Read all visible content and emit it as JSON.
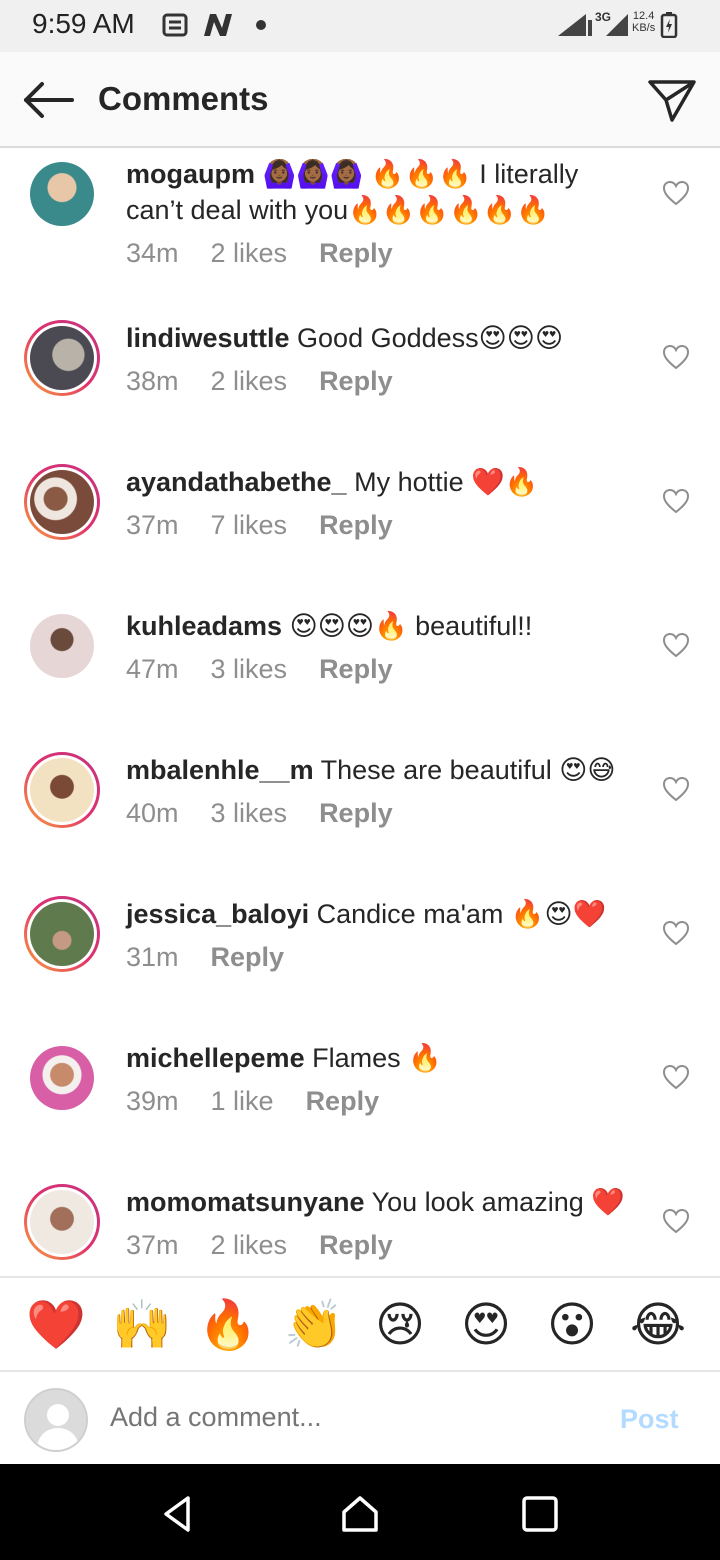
{
  "status_bar": {
    "time": "9:59 AM",
    "network": "3G",
    "speed_value": "12.4",
    "speed_unit": "KB/s",
    "icons": [
      "notification-icon",
      "n-app-icon",
      "signal-icon",
      "battery-icon"
    ]
  },
  "header": {
    "title": "Comments",
    "back_icon": "arrow-left-icon",
    "send_icon": "paper-plane-icon"
  },
  "comments": [
    {
      "username": "mogaupm",
      "text_line1": " 🙆🏾‍♀️🙆🏾‍♀️🙆🏾‍♀️ 🔥🔥🔥 I literally",
      "text_line2": "can’t deal with you🔥🔥🔥🔥🔥🔥",
      "time": "34m",
      "likes": "2 likes",
      "reply": "Reply",
      "avatar_color": "#3a8a8c",
      "ring": false
    },
    {
      "username": "lindiwesuttle",
      "text": " Good Goddess😍😍😍",
      "time": "38m",
      "likes": "2 likes",
      "reply": "Reply",
      "avatar_color": "#6b6a72",
      "ring": true
    },
    {
      "username": "ayandathabethe_",
      "text": " My hottie ❤️🔥",
      "time": "37m",
      "likes": "7 likes",
      "reply": "Reply",
      "avatar_color": "#7a4b3a",
      "ring": true
    },
    {
      "username": "kuhleadams",
      "text": " 😍😍😍🔥 beautiful!!",
      "time": "47m",
      "likes": "3 likes",
      "reply": "Reply",
      "avatar_color": "#c7a9a8",
      "ring": false
    },
    {
      "username": "mbalenhle__m",
      "text": " These are beautiful 😍😅",
      "time": "40m",
      "likes": "3 likes",
      "reply": "Reply",
      "avatar_color": "#d9b48a",
      "ring": true
    },
    {
      "username": "jessica_baloyi",
      "text": " Candice ma'am 🔥😍❤️",
      "time": "31m",
      "likes": "",
      "reply": "Reply",
      "avatar_color": "#5f7a4c",
      "ring": true
    },
    {
      "username": "michellepeme",
      "text": " Flames 🔥",
      "time": "39m",
      "likes": "1 like",
      "reply": "Reply",
      "avatar_color": "#d85fa5",
      "ring": false
    },
    {
      "username": "momomatsunyane",
      "text": " You look amazing ❤️",
      "time": "37m",
      "likes": "2 likes",
      "reply": "Reply",
      "avatar_color": "#8c7b6a",
      "ring": true
    }
  ],
  "emoji_bar": [
    "❤️",
    "🙌",
    "🔥",
    "👏",
    "😢",
    "😍",
    "😮",
    "😂"
  ],
  "composer": {
    "placeholder": "Add a comment...",
    "post_label": "Post"
  },
  "nav_bar": {
    "back_icon": "triangle-back-icon",
    "home_icon": "home-icon",
    "recents_icon": "recents-icon"
  }
}
